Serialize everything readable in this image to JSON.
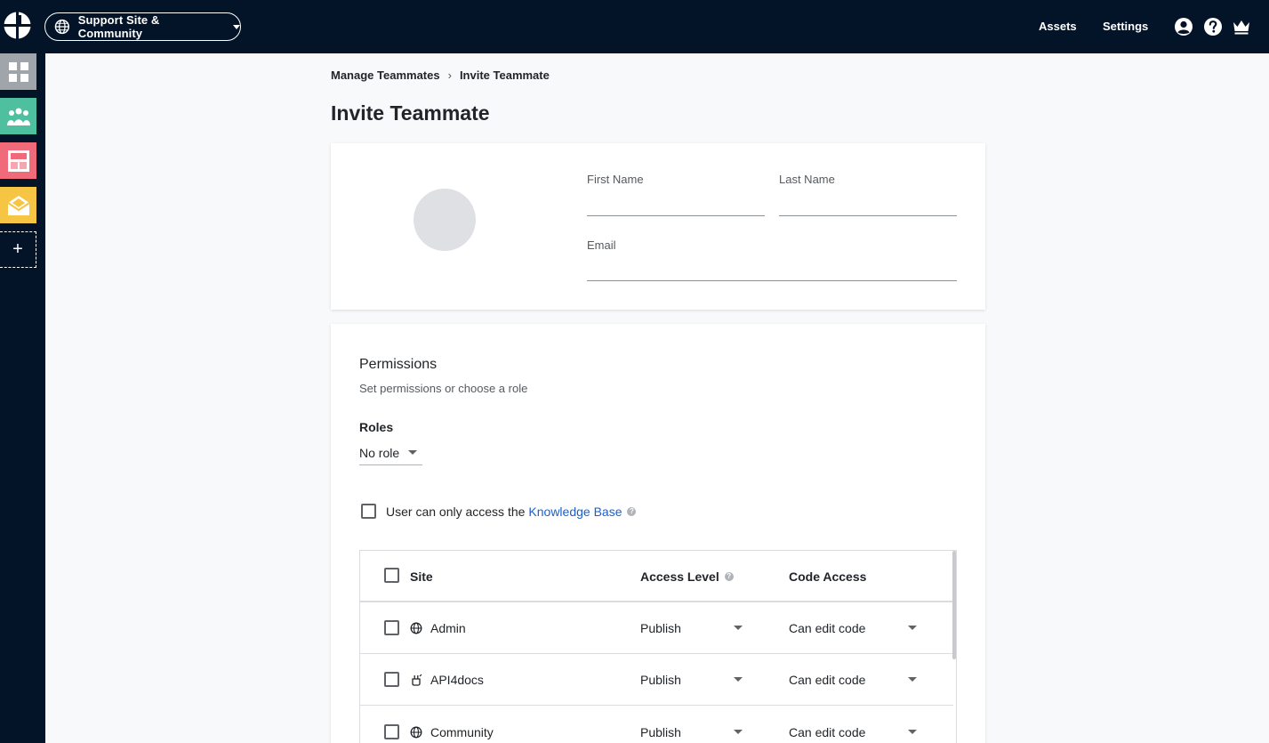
{
  "topbar": {
    "site_switcher_label": "Support Site & Community",
    "nav": [
      "Assets",
      "Settings"
    ],
    "icons": [
      "account-icon",
      "help-icon",
      "crown-icon"
    ]
  },
  "rail": {
    "items": [
      {
        "name": "dashboard",
        "color": "#a0a4ab"
      },
      {
        "name": "teammates",
        "color": "#4ebf9f"
      },
      {
        "name": "layout",
        "color": "#f06a7a"
      },
      {
        "name": "mail",
        "color": "#f7c544"
      }
    ],
    "add_label": "+"
  },
  "breadcrumb": {
    "parent": "Manage Teammates",
    "separator": "›",
    "current": "Invite Teammate"
  },
  "page_title": "Invite Teammate",
  "profile": {
    "first_name_label": "First Name",
    "last_name_label": "Last Name",
    "email_label": "Email",
    "first_name_value": "",
    "last_name_value": "",
    "email_value": ""
  },
  "permissions": {
    "title": "Permissions",
    "subtitle": "Set permissions or choose a role",
    "roles_label": "Roles",
    "role_value": "No role",
    "kb_text": "User can only access the",
    "kb_link": "Knowledge Base",
    "kb_help": "?",
    "table": {
      "headers": {
        "site": "Site",
        "access": "Access Level",
        "access_help": "?",
        "code": "Code Access"
      },
      "rows": [
        {
          "site": "Admin",
          "icon": "globe-icon",
          "access": "Publish",
          "code": "Can edit code"
        },
        {
          "site": "API4docs",
          "icon": "api-icon",
          "access": "Publish",
          "code": "Can edit code"
        },
        {
          "site": "Community",
          "icon": "globe-icon",
          "access": "Publish",
          "code": "Can edit code"
        }
      ]
    }
  },
  "colors": {
    "topbar": "#041428",
    "link": "#1a5fd1"
  }
}
